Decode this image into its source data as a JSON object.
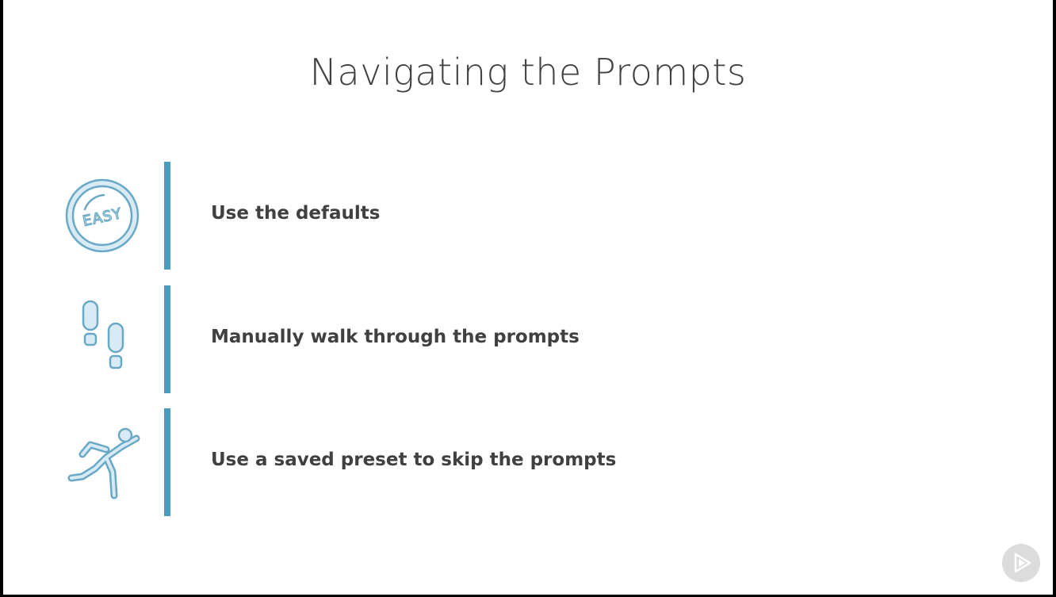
{
  "slide": {
    "title": "Navigating the Prompts"
  },
  "items": [
    {
      "icon": "easy-button-icon",
      "text": "Use the defaults"
    },
    {
      "icon": "footprints-icon",
      "text": "Manually walk through the prompts"
    },
    {
      "icon": "running-person-icon",
      "text": "Use a saved preset to skip the prompts"
    }
  ],
  "easy_icon_label": "EASY",
  "player": {
    "icon": "play-logo-icon"
  },
  "colors": {
    "accent": "#4a9bbd",
    "icon_fill": "#d8ebf4",
    "icon_stroke": "#6aa9c6",
    "text": "#404040",
    "background": "#ffffff",
    "play_button": "#dcdcdc"
  }
}
